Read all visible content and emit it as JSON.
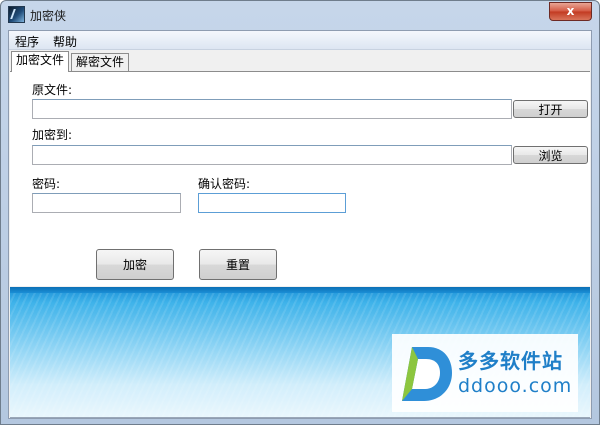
{
  "window": {
    "title": "加密侠",
    "close_label": "x"
  },
  "menu": {
    "items": [
      "程序",
      "帮助"
    ]
  },
  "tabs": [
    {
      "label": "加密文件",
      "active": true
    },
    {
      "label": "解密文件",
      "active": false
    }
  ],
  "form": {
    "source_label": "原文件:",
    "source_value": "",
    "open_button": "打开",
    "target_label": "加密到:",
    "target_value": "",
    "browse_button": "浏览",
    "password_label": "密码:",
    "password_value": "",
    "confirm_label": "确认密码:",
    "confirm_value": "",
    "encrypt_button": "加密",
    "reset_button": "重置"
  },
  "watermark": {
    "title": "多多软件站",
    "url": "ddooo.com"
  },
  "colors": {
    "banner_top": "#1a8fd6",
    "watermark_text": "#1f7fc8",
    "close_button": "#c23a22"
  }
}
